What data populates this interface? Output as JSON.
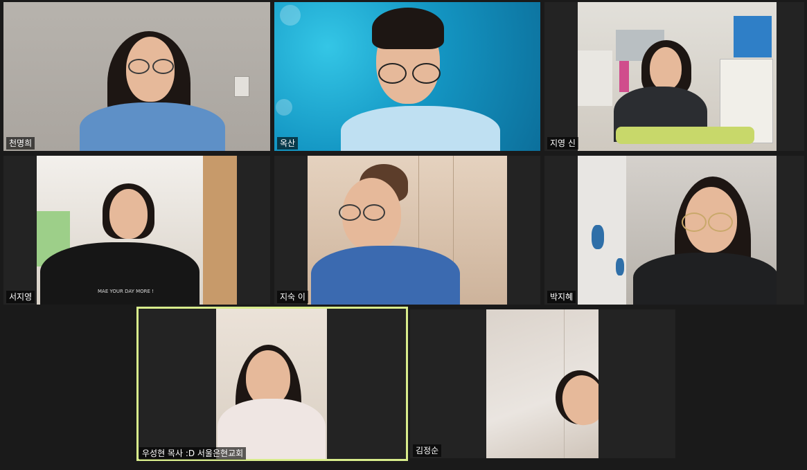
{
  "participants": [
    {
      "name": "천명희"
    },
    {
      "name": "옥산"
    },
    {
      "name": "지영 신"
    },
    {
      "name": "서지영"
    },
    {
      "name": "지숙 이"
    },
    {
      "name": "박지혜"
    },
    {
      "name": "우성현 목사 :D 서울은현교회",
      "speaking": true
    },
    {
      "name": "김정순"
    }
  ],
  "t_shirt_text": "MAE YOUR DAY MORE !",
  "colors": {
    "active_speaker_border": "#d8ec8c",
    "background": "#1a1a1a",
    "tile_background": "#232323"
  }
}
